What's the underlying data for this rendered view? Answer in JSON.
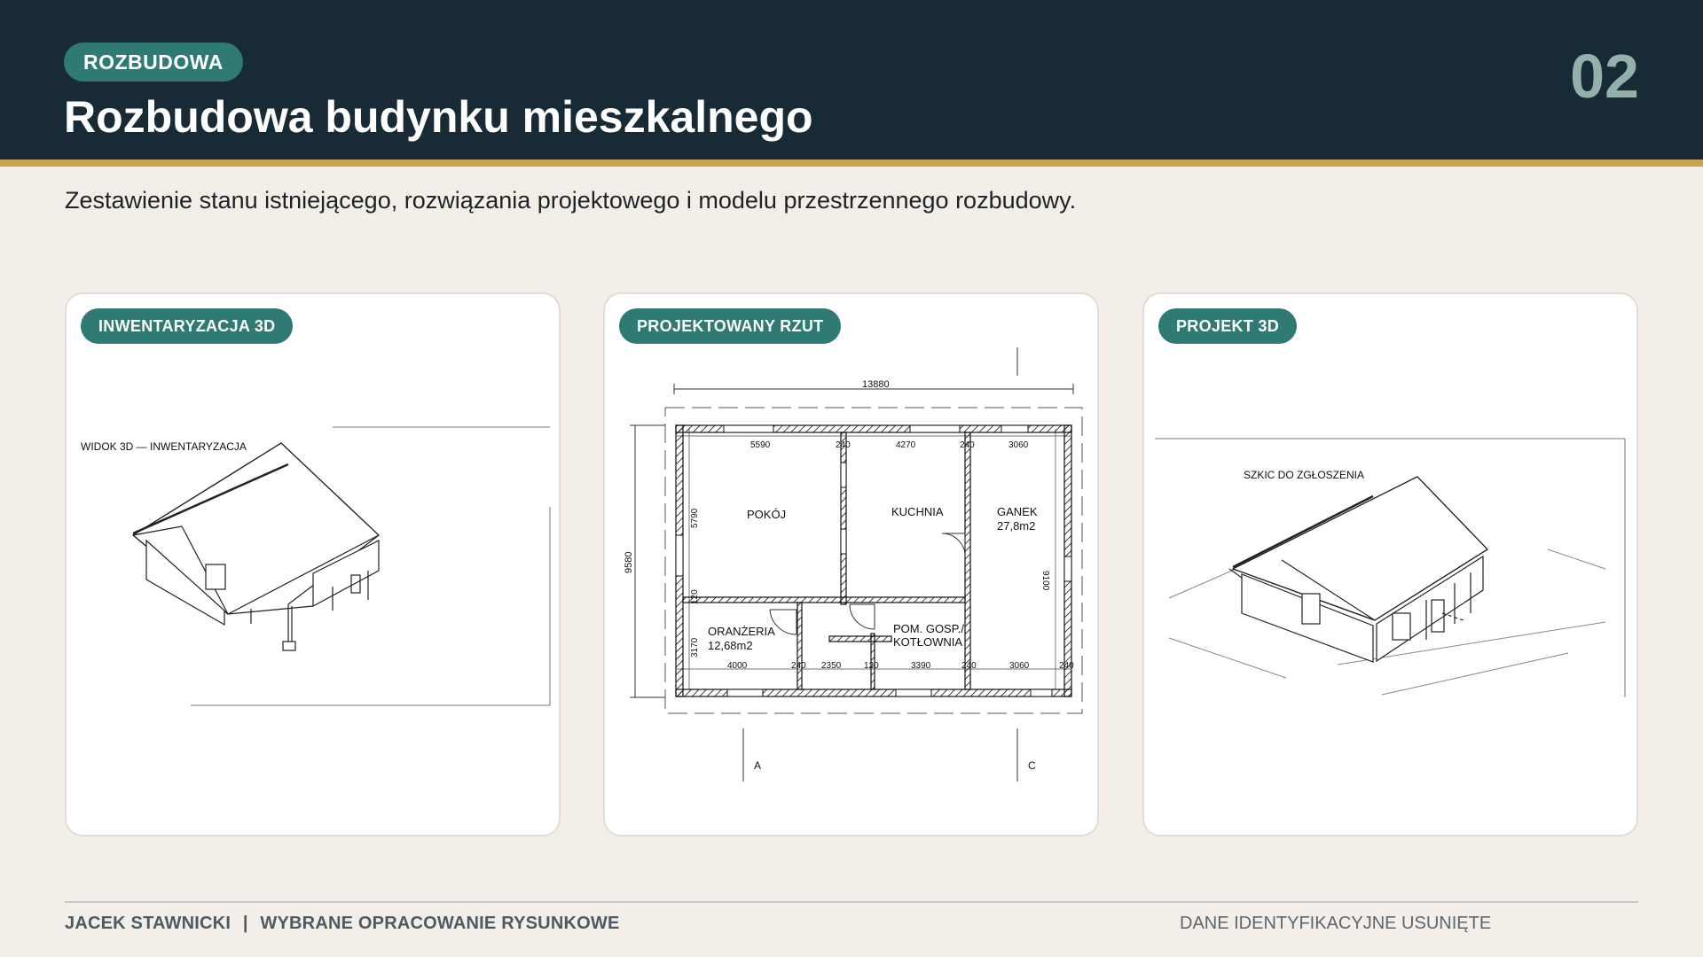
{
  "header": {
    "badge": "ROZBUDOWA",
    "title": "Rozbudowa budynku mieszkalnego",
    "page_number": "02"
  },
  "subtitle": "Zestawienie stanu istniejącego, rozwiązania projektowego i modelu przestrzennego rozbudowy.",
  "cards": [
    {
      "badge": "INWENTARYZACJA 3D",
      "caption": "WIDOK 3D — INWENTARYZACJA"
    },
    {
      "badge": "PROJEKTOWANY RZUT",
      "plan": {
        "overall_width": "13880",
        "overall_depth": "9580",
        "top_dims": [
          "5590",
          "240",
          "4270",
          "240",
          "3060"
        ],
        "bottom_dims": [
          "4000",
          "240",
          "2350",
          "120",
          "3390",
          "240",
          "3060",
          "240"
        ],
        "left_dims": [
          "5790",
          "120",
          "3170"
        ],
        "right_dim": "9100",
        "rooms": {
          "pokoj": "POKÓJ",
          "kuchnia": "KUCHNIA",
          "ganek_name": "GANEK",
          "ganek_area": "27,8m2",
          "oranzeria_name": "ORANŻERIA",
          "oranzeria_area": "12,68m2",
          "pom_line1": "POM. GOSP./",
          "pom_line2": "KOTŁOWNIA"
        },
        "axis_a": "A",
        "axis_c": "C"
      }
    },
    {
      "badge": "PROJEKT 3D",
      "caption": "SZKIC DO ZGŁOSZENIA"
    }
  ],
  "footer": {
    "author": "JACEK STAWNICKI",
    "separator": "|",
    "description": "WYBRANE OPRACOWANIE RYSUNKOWE",
    "note": "DANE IDENTYFIKACYJNE USUNIĘTE"
  }
}
